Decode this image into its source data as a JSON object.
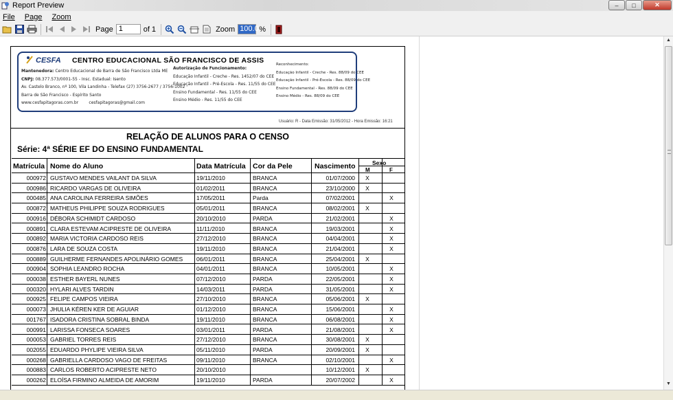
{
  "window": {
    "title": "Report Preview"
  },
  "menu": {
    "file": "File",
    "page": "Page",
    "zoom": "Zoom"
  },
  "toolbar": {
    "page_label": "Page",
    "page_value": "1",
    "page_of": "of 1",
    "zoom_label": "Zoom",
    "zoom_value": "100.0",
    "zoom_unit": "%"
  },
  "header": {
    "logo": "CESFA",
    "school": "CENTRO EDUCACIONAL SÃO FRANCISCO DE ASSIS",
    "mantenedora_label": "Mantenedora:",
    "mantenedora": "Centro Educacional de Barra de São Francisco Ltda ME",
    "cnpj_label": "CNPJ:",
    "cnpj": "08.377.573/0001-55 - Insc. Estadual: Isento",
    "address": "Av. Castelo Branco, nº 100, Vila Landinha - Telefax (27) 3756-2677 / 3756-1002",
    "city": "Barra de São Francisco - Espírito Santo",
    "site": "www.cesfapitagoras.com.br",
    "email": "cesfapitagoras@gmail.com",
    "autorizacao_title": "Autorização de Funcionamento:",
    "autorizacao": [
      "Educação Infantil - Creche - Res. 1452/07 do CEE",
      "Educação Infantil - Pré-Escola - Res. 11/55 do CEE",
      "Ensino Fundamental - Res. 11/55 do CEE",
      "Ensino Médio - Res. 11/55 do CEE"
    ],
    "reconhecimento_title": "Reconhecimento:",
    "reconhecimento": [
      "Educação Infantil - Creche - Res. 88/09 do CEE",
      "Educação Infantil - Pré-Escola - Res. 88/09 do CEE",
      "Ensino Fundamental - Res. 88/09 do CEE",
      "Ensino Médio - Res. 88/09 do CEE"
    ],
    "user_line": "Usuário: R - Data Emissão: 31/05/2012 - Hora Emissão: 16:21"
  },
  "report": {
    "title": "RELAÇÃO DE ALUNOS PARA O CENSO",
    "serie": "Série: 4ª SÉRIE EF DO ENSINO FUNDAMENTAL",
    "columns": {
      "matricula": "Matrícula",
      "nome": "Nome do Aluno",
      "data_matricula": "Data Matrícula",
      "cor": "Cor da Pele",
      "nascimento": "Nascimento",
      "sexo": "Sexo",
      "m": "M",
      "f": "F"
    },
    "rows": [
      [
        "000972",
        "GUSTAVO MENDES VAILANT DA SILVA",
        "19/11/2010",
        "BRANCA",
        "01/07/2000",
        "X",
        ""
      ],
      [
        "000986",
        "RICARDO VARGAS DE OLIVEIRA",
        "01/02/2011",
        "BRANCA",
        "23/10/2000",
        "X",
        ""
      ],
      [
        "000485",
        "ANA CAROLINA FERREIRA SIMÕES",
        "17/05/2011",
        "Parda",
        "07/02/2001",
        "",
        "X"
      ],
      [
        "000872",
        "MATHEUS PHILIPPE SOUZA RODRIGUES",
        "05/01/2011",
        "BRANCA",
        "08/02/2001",
        "X",
        ""
      ],
      [
        "000916",
        "DÉBORA SCHIMIDT CARDOSO",
        "20/10/2010",
        "PARDA",
        "21/02/2001",
        "",
        "X"
      ],
      [
        "000891",
        "CLARA ESTEVAM ACIPRESTE DE OLIVEIRA",
        "11/11/2010",
        "BRANCA",
        "19/03/2001",
        "",
        "X"
      ],
      [
        "000892",
        "MARIA VICTORIA CARDOSO REIS",
        "27/12/2010",
        "BRANCA",
        "04/04/2001",
        "",
        "X"
      ],
      [
        "000876",
        "LARA DE SOUZA COSTA",
        "19/11/2010",
        "BRANCA",
        "21/04/2001",
        "",
        "X"
      ],
      [
        "000889",
        "GUILHERME FERNANDES APOLINÁRIO GOMES",
        "06/01/2011",
        "BRANCA",
        "25/04/2001",
        "X",
        ""
      ],
      [
        "000904",
        "SOPHIA LEANDRO ROCHA",
        "04/01/2011",
        "BRANCA",
        "10/05/2001",
        "",
        "X"
      ],
      [
        "000038",
        "ESTHER BAYERL NUNES",
        "07/12/2010",
        "PARDA",
        "22/05/2001",
        "",
        "X"
      ],
      [
        "000320",
        "HYLARI ALVES TARDIN",
        "14/03/2011",
        "PARDA",
        "31/05/2001",
        "",
        "X"
      ],
      [
        "000925",
        "FELIPE CAMPOS VIEIRA",
        "27/10/2010",
        "BRANCA",
        "05/06/2001",
        "X",
        ""
      ],
      [
        "000073",
        "JHULIA KÉREN KER DE AGUIAR",
        "01/12/2010",
        "BRANCA",
        "15/06/2001",
        "",
        "X"
      ],
      [
        "001767",
        "ISADORA CRISTINA SOBRAL BINDA",
        "19/11/2010",
        "BRANCA",
        "06/08/2001",
        "",
        "X"
      ],
      [
        "000991",
        "LARISSA FONSECA SOARES",
        "03/01/2011",
        "PARDA",
        "21/08/2001",
        "",
        "X"
      ],
      [
        "000053",
        "GABRIEL TORRES REIS",
        "27/12/2010",
        "BRANCA",
        "30/08/2001",
        "X",
        ""
      ],
      [
        "002055",
        "EDUARDO PHYLIPE VIEIRA SILVA",
        "05/11/2010",
        "PARDA",
        "20/09/2001",
        "X",
        ""
      ],
      [
        "000268",
        "GABRIELLA CARDOSO VAGO DE FREITAS",
        "09/11/2010",
        "BRANCA",
        "02/10/2001",
        "",
        "X"
      ],
      [
        "000883",
        "CARLOS ROBERTO ACIPRESTE NETO",
        "20/10/2010",
        "",
        "10/12/2001",
        "X",
        ""
      ],
      [
        "000262",
        "ELOÍSA FIRMINO ALMEIDA DE AMORIM",
        "19/11/2010",
        "PARDA",
        "20/07/2002",
        "",
        "X"
      ]
    ]
  }
}
